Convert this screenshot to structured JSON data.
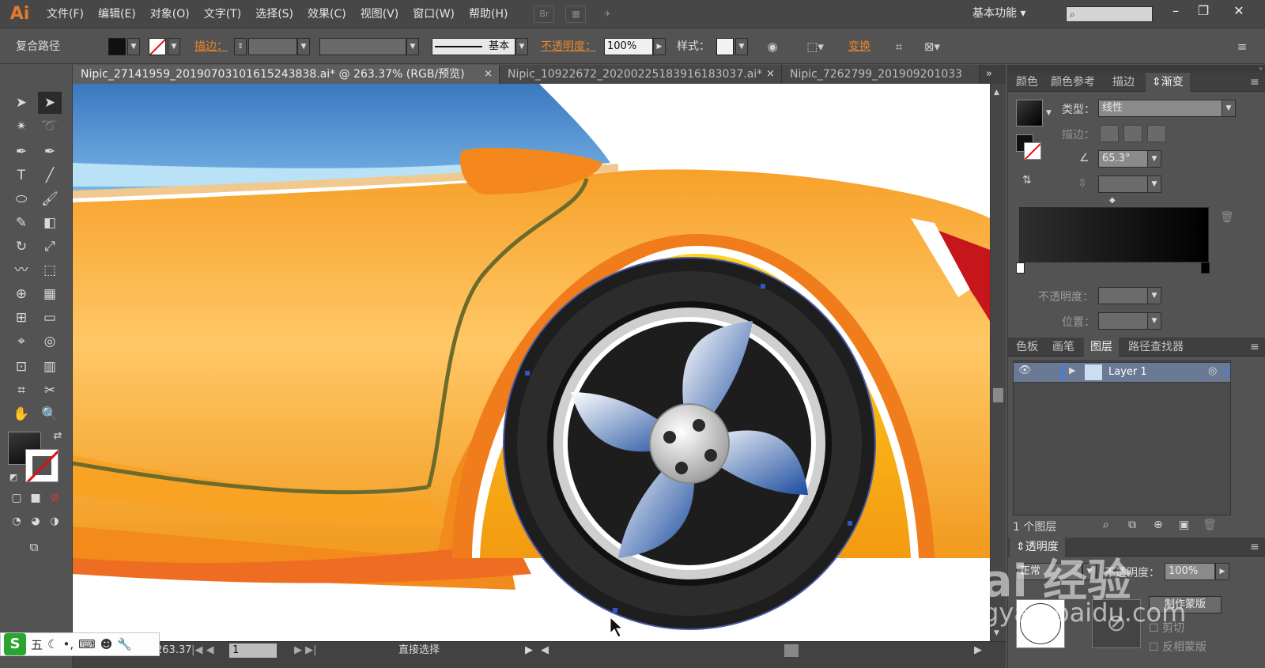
{
  "app": {
    "logo": "Ai",
    "menus": [
      "文件(F)",
      "编辑(E)",
      "对象(O)",
      "文字(T)",
      "选择(S)",
      "效果(C)",
      "视图(V)",
      "窗口(W)",
      "帮助(H)"
    ],
    "bridge_icon": "Br",
    "workspace": "基本功能",
    "search_placeholder": "",
    "window_controls": [
      "minimize-icon",
      "restore-icon",
      "close-icon"
    ]
  },
  "control_bar": {
    "selection_type": "复合路径",
    "stroke_label": "描边：",
    "stroke_style": "基本",
    "opacity_label": "不透明度：",
    "opacity_value": "100%",
    "style_label": "样式：",
    "transform_link": "变换"
  },
  "document_tabs": [
    {
      "label": "Nipic_27141959_20190703101615243838.ai* @ 263.37% (RGB/预览)",
      "active": true
    },
    {
      "label": "Nipic_10922672_20200225183916183037.ai*",
      "active": false
    },
    {
      "label": "Nipic_7262799_201909201033",
      "active": false
    }
  ],
  "status_bar": {
    "zoom": "263.37",
    "artboard_number": "1",
    "tool_status": "直接选择"
  },
  "gradient_panel": {
    "tabs": [
      "颜色",
      "颜色参考",
      "描边",
      "渐变"
    ],
    "active_tab": "渐变",
    "type_label": "类型：",
    "type_value": "线性",
    "stroke_label": "描边：",
    "angle_value": "65.3°",
    "opacity_label": "不透明度：",
    "position_label": "位置：",
    "stop_colors": [
      "#ffffff",
      "#000000"
    ]
  },
  "layers_panel": {
    "tabs": [
      "色板",
      "画笔",
      "图层",
      "路径查找器"
    ],
    "active_tab": "图层",
    "layer_name": "Layer 1",
    "layer_count": "1 个图层"
  },
  "transparency_panel": {
    "title": "透明度",
    "blend_mode": "正常",
    "opacity_label": "不透明度：",
    "opacity_value": "100%",
    "make_mask_button": "制作蒙版",
    "clip_label": "剪切",
    "invert_mask_label": "反相蒙版"
  },
  "watermark": {
    "brand": "Bai 经验",
    "url": "jingyan.baidu.com"
  },
  "ime": {
    "logo": "S",
    "mode": "五"
  },
  "colors": {
    "car_orange": "#f08c1a",
    "car_light": "#ffc24a",
    "wheel_blue": "#1c4f9c",
    "accent_link": "#e8862f"
  }
}
